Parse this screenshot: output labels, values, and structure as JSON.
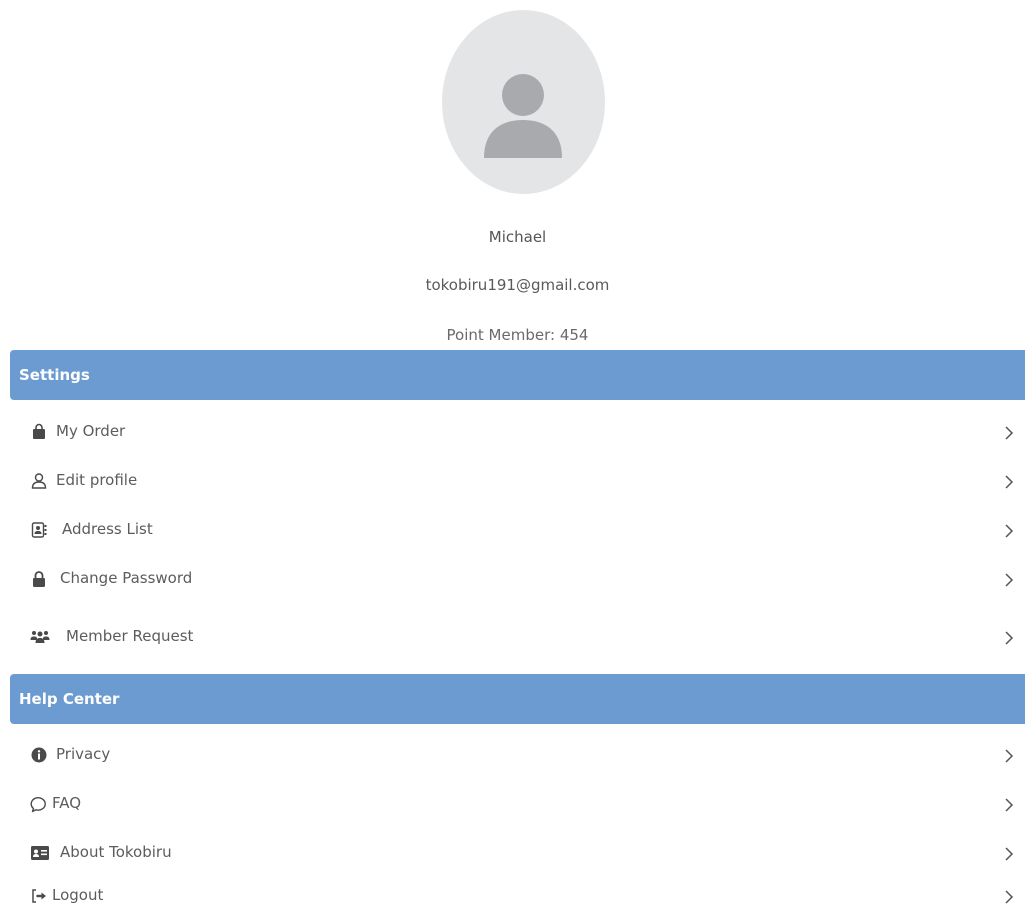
{
  "profile": {
    "name": "Michael",
    "email": "tokobiru191@gmail.com",
    "points": "Point Member: 454"
  },
  "sections": {
    "settings": {
      "title": "Settings",
      "items": [
        {
          "label": "My Order",
          "icon": "shopping-bag-icon"
        },
        {
          "label": "Edit profile",
          "icon": "user-icon"
        },
        {
          "label": "Address List",
          "icon": "address-book-icon"
        },
        {
          "label": "Change Password",
          "icon": "lock-icon"
        },
        {
          "label": "Member Request",
          "icon": "users-icon"
        }
      ]
    },
    "help": {
      "title": "Help Center",
      "items": [
        {
          "label": "Privacy",
          "icon": "info-icon"
        },
        {
          "label": "FAQ",
          "icon": "chat-bubble-icon"
        },
        {
          "label": "About Tokobiru",
          "icon": "id-card-icon"
        },
        {
          "label": "Logout",
          "icon": "logout-icon"
        }
      ]
    }
  },
  "colors": {
    "section_header": "#6b9bd1",
    "avatar_bg": "#e4e5e7",
    "avatar_fg": "#a8aaad"
  }
}
